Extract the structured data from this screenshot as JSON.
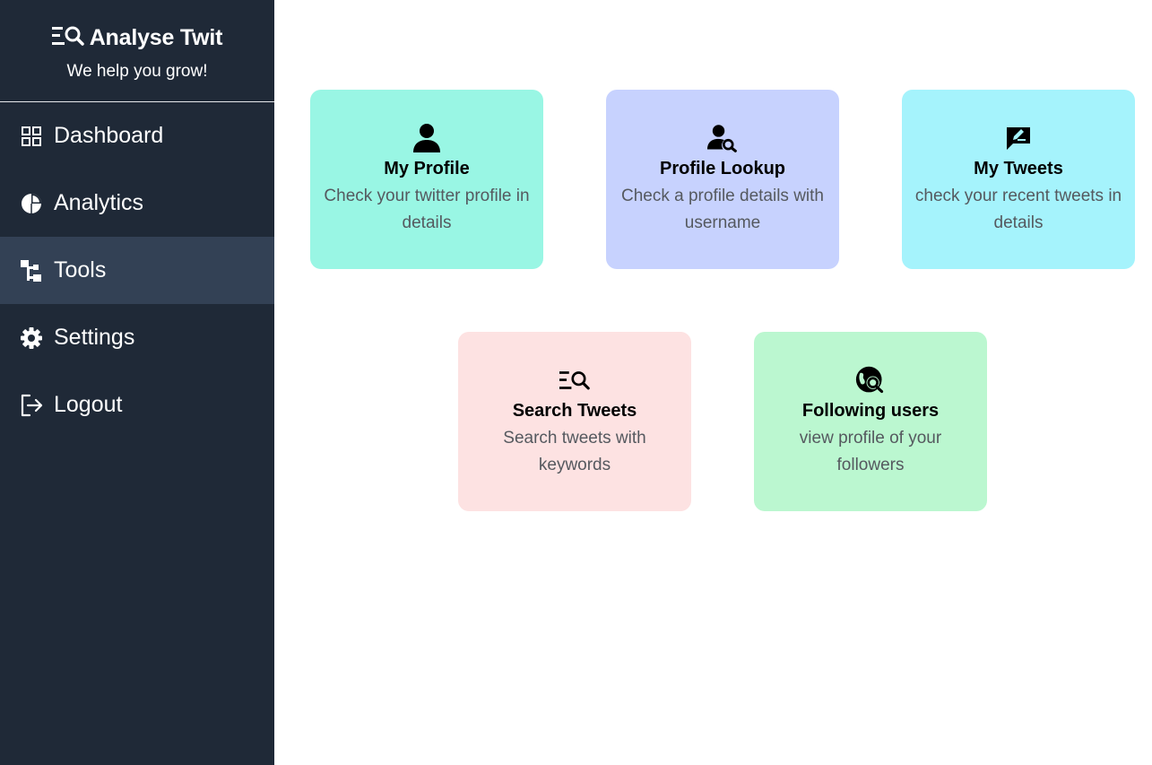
{
  "app": {
    "title": "Analyse Twit",
    "tagline": "We help you grow!",
    "logo_icon": "search-list-icon"
  },
  "colors": {
    "sidebar_bg": "#1f2937",
    "sidebar_active": "#334155",
    "card_profile": "#99f6e4",
    "card_lookup": "#c7d2fe",
    "card_tweets": "#a5f3fc",
    "card_search": "#fde2e2",
    "card_following": "#bbf7d0"
  },
  "sidebar": {
    "items": [
      {
        "label": "Dashboard",
        "icon": "grid-icon",
        "active": false
      },
      {
        "label": "Analytics",
        "icon": "pie-chart-icon",
        "active": false
      },
      {
        "label": "Tools",
        "icon": "tree-structure-icon",
        "active": true
      },
      {
        "label": "Settings",
        "icon": "gear-icon",
        "active": false
      },
      {
        "label": "Logout",
        "icon": "logout-icon",
        "active": false
      }
    ]
  },
  "cards": [
    {
      "title": "My Profile",
      "description": "Check your twitter profile in details",
      "icon": "person-icon"
    },
    {
      "title": "Profile Lookup",
      "description": "Check a profile details with username",
      "icon": "person-search-icon"
    },
    {
      "title": "My Tweets",
      "description": "check your recent tweets in details",
      "icon": "chat-edit-icon"
    },
    {
      "title": "Search Tweets",
      "description": "Search tweets with keywords",
      "icon": "search-list-icon"
    },
    {
      "title": "Following users",
      "description": "view profile of your followers",
      "icon": "globe-search-icon"
    }
  ]
}
